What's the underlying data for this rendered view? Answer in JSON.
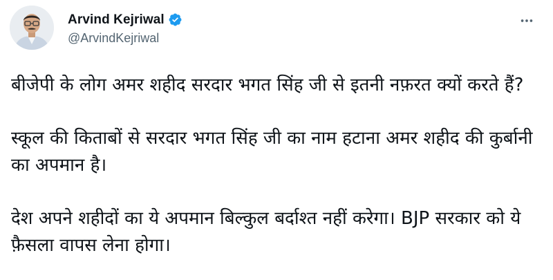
{
  "author": {
    "display_name": "Arvind Kejriwal",
    "handle": "@ArvindKejriwal",
    "verified": true
  },
  "tweet": {
    "paragraphs": [
      "बीजेपी के लोग अमर शहीद सरदार भगत सिंह जी से इतनी नफ़रत क्यों करते हैं?",
      "स्कूल की किताबों से सरदार भगत सिंह जी का नाम हटाना अमर शहीद की कुर्बानी का अपमान है।",
      "देश अपने शहीदों का ये अपमान बिल्कुल बर्दाश्त नहीं करेगा। BJP सरकार को ये फ़ैसला वापस लेना होगा।"
    ]
  },
  "icons": {
    "verified": "verified-badge-icon",
    "more": "more-options-icon"
  },
  "colors": {
    "text": "#0f1419",
    "secondary": "#536471",
    "verified": "#1d9bf0"
  }
}
